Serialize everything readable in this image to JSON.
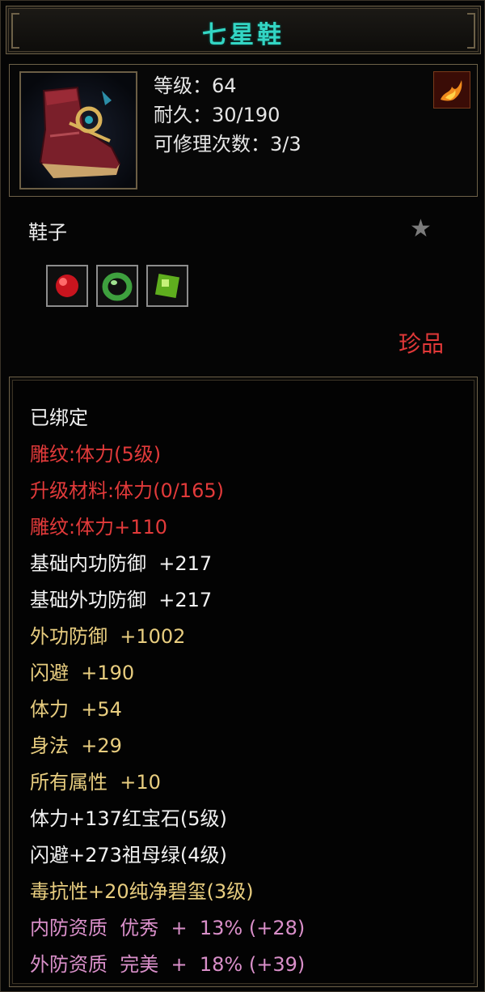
{
  "item": {
    "name": "七星鞋",
    "level": "等级：64",
    "durability": "耐久：30/190",
    "repairs": "可修理次数：3/3",
    "type": "鞋子",
    "rarity": "珍品"
  },
  "attributes": [
    {
      "text": "已绑定",
      "color": "white"
    },
    {
      "text": "雕纹:体力(5级)",
      "color": "red"
    },
    {
      "text": "升级材料:体力(0/165)",
      "color": "red"
    },
    {
      "text": "雕纹:体力+110",
      "color": "red"
    },
    {
      "text": "基础内功防御  +217",
      "color": "white"
    },
    {
      "text": "基础外功防御  +217",
      "color": "white"
    },
    {
      "text": "外功防御  +1002",
      "color": "gold"
    },
    {
      "text": "闪避  +190",
      "color": "gold"
    },
    {
      "text": "体力  +54",
      "color": "gold"
    },
    {
      "text": "身法  +29",
      "color": "gold"
    },
    {
      "text": "所有属性  +10",
      "color": "gold"
    },
    {
      "text": "体力+137红宝石(5级)",
      "color": "white"
    },
    {
      "text": "闪避+273祖母绿(4级)",
      "color": "white"
    },
    {
      "text": "毒抗性+20纯净碧玺(3级)",
      "color": "gold"
    },
    {
      "text": "内防资质  优秀  +  13% (+28)",
      "color": "pink"
    },
    {
      "text": "外防资质  完美  +  18% (+39)",
      "color": "pink"
    }
  ],
  "icons": {
    "item_image": "boot-icon",
    "badge": "flame-icon",
    "star": "star-icon",
    "gems": [
      "ruby-gem-icon",
      "jade-ring-icon",
      "emerald-gem-icon"
    ]
  },
  "colors": {
    "title": "#33d6c4",
    "red": "#e23a3a",
    "gold": "#e8cd7f",
    "pink": "#d98fc9",
    "white": "#f2f2f2"
  }
}
